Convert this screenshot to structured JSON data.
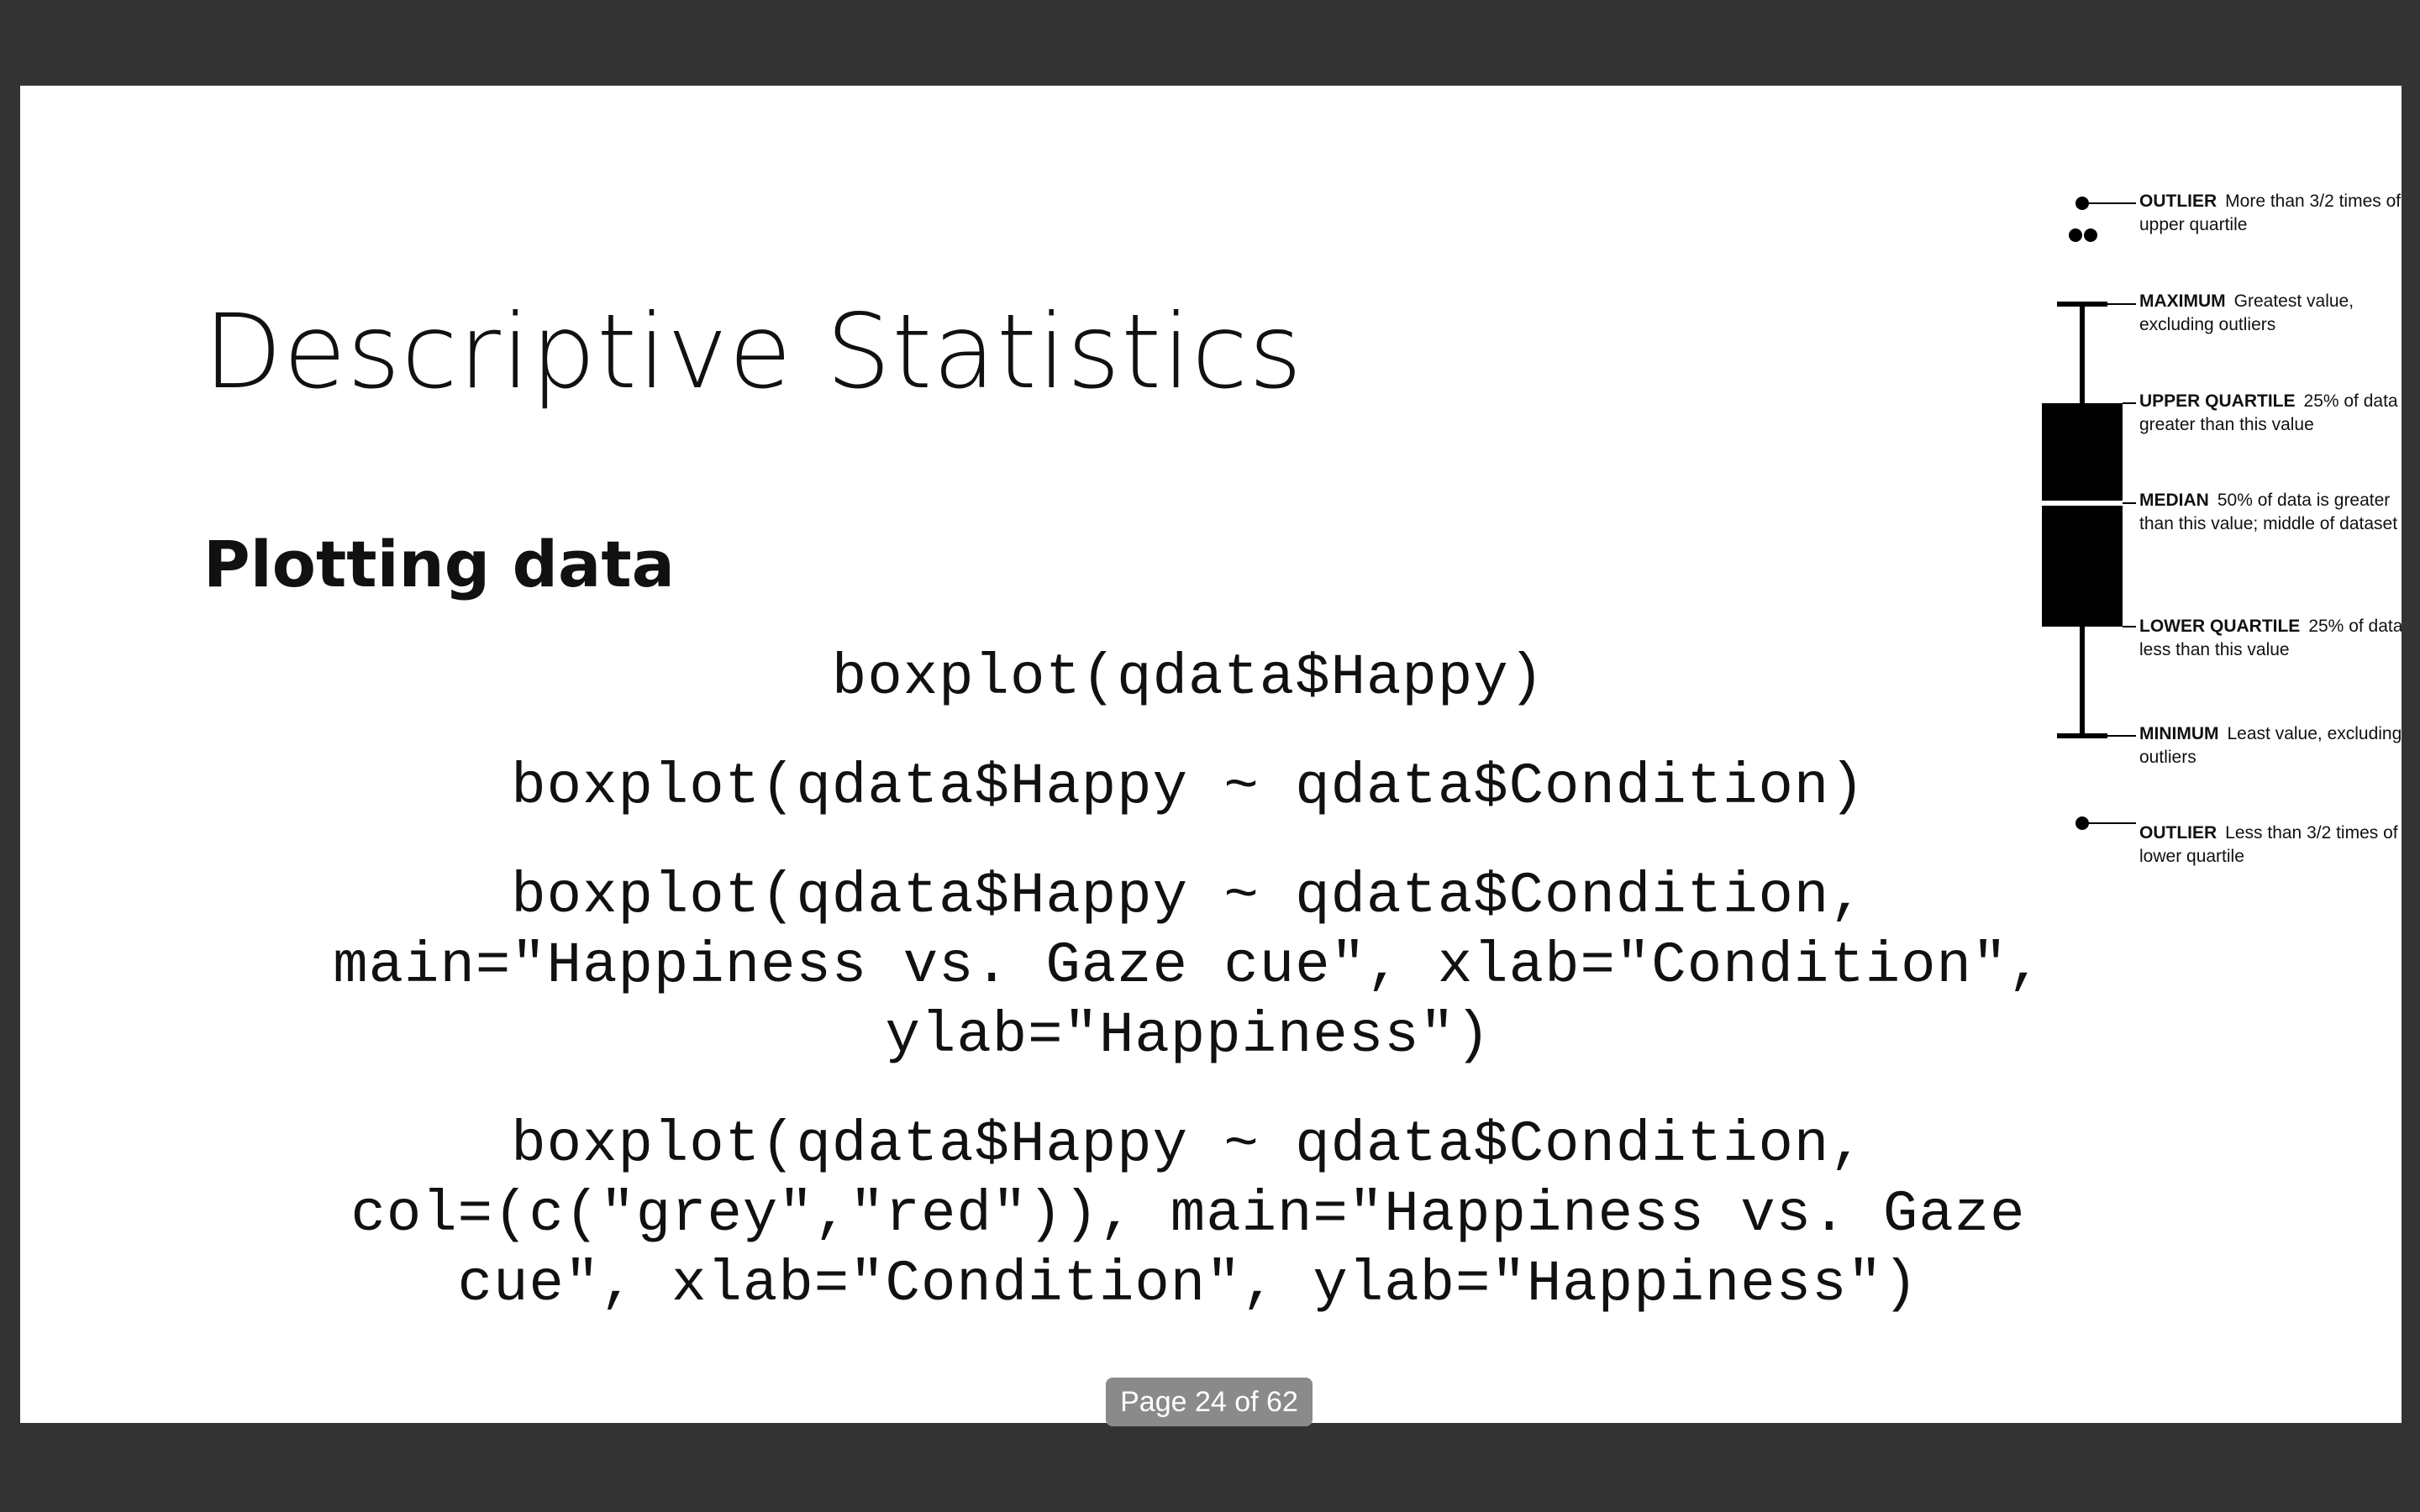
{
  "slide": {
    "title": "Descriptive Statistics",
    "subtitle": "Plotting data",
    "code": [
      "boxplot(qdata$Happy)",
      "boxplot(qdata$Happy ~ qdata$Condition)",
      "boxplot(qdata$Happy ~ qdata$Condition,\nmain=\"Happiness vs. Gaze cue\", xlab=\"Condition\",\nylab=\"Happiness\")",
      "boxplot(qdata$Happy ~ qdata$Condition,\ncol=(c(\"grey\",\"red\")), main=\"Happiness vs. Gaze\ncue\", xlab=\"Condition\", ylab=\"Happiness\")"
    ]
  },
  "boxplot_legend": {
    "entries": [
      {
        "term": "OUTLIER",
        "desc": "More than 3/2 times of upper quartile"
      },
      {
        "term": "MAXIMUM",
        "desc": "Greatest value, excluding outliers"
      },
      {
        "term": "UPPER QUARTILE",
        "desc": "25% of data greater than this value"
      },
      {
        "term": "MEDIAN",
        "desc": "50% of data is greater than this value; middle of dataset"
      },
      {
        "term": "LOWER QUARTILE",
        "desc": "25% of data less than this value"
      },
      {
        "term": "MINIMUM",
        "desc": "Least value, excluding outliers"
      },
      {
        "term": "OUTLIER",
        "desc": "Less than 3/2 times of lower quartile"
      }
    ]
  },
  "viewer": {
    "page_indicator": "Page 24 of 62"
  },
  "colors": {
    "background": "#333333",
    "slide": "#ffffff",
    "text": "#111111",
    "page_indicator_bg": "#8a8a8a"
  }
}
